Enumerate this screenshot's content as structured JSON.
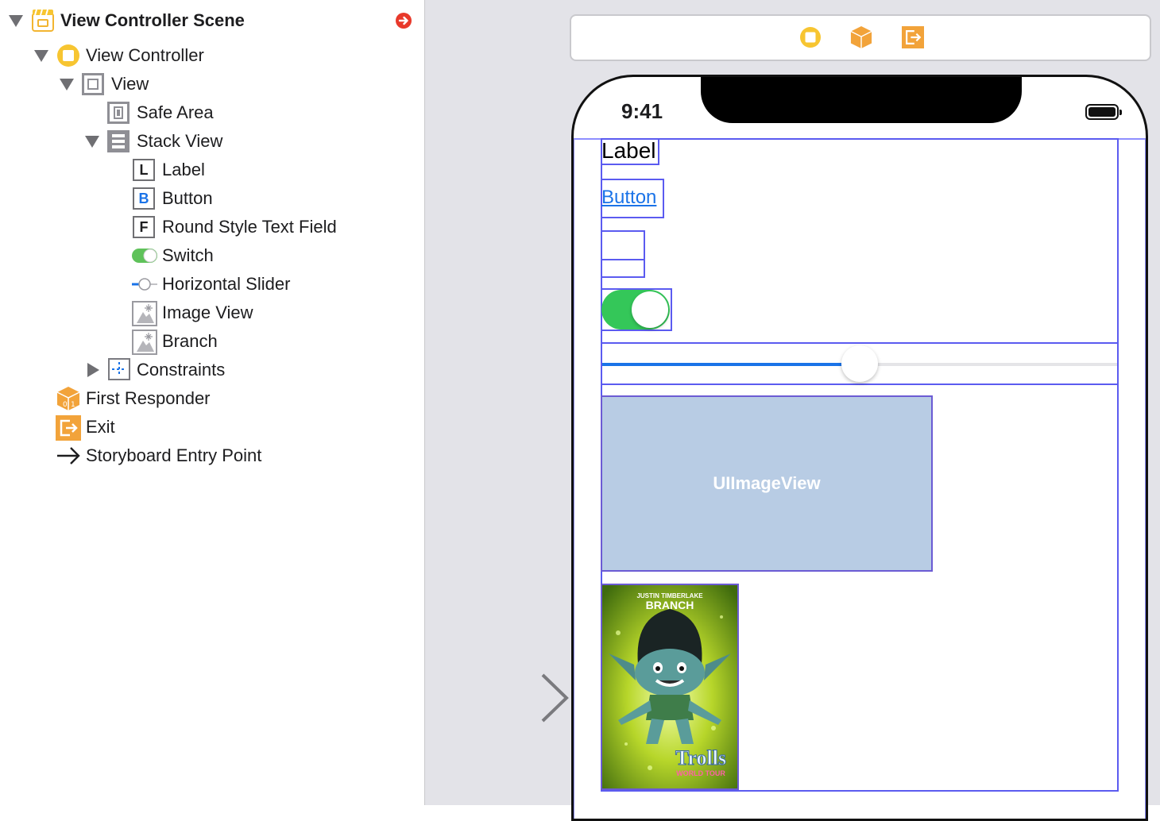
{
  "outline": {
    "scene": {
      "label": "View Controller Scene",
      "icon": "storyboard-scene-icon"
    },
    "items": [
      {
        "label": "View Controller"
      },
      {
        "label": "View"
      },
      {
        "label": "Safe Area"
      },
      {
        "label": "Stack View"
      },
      {
        "label": "Label",
        "badge": "L"
      },
      {
        "label": "Button",
        "badge": "B"
      },
      {
        "label": "Round Style Text Field",
        "badge": "F"
      },
      {
        "label": "Switch"
      },
      {
        "label": "Horizontal Slider"
      },
      {
        "label": "Image View"
      },
      {
        "label": "Branch"
      },
      {
        "label": "Constraints"
      },
      {
        "label": "First Responder"
      },
      {
        "label": "Exit"
      },
      {
        "label": "Storyboard Entry Point"
      }
    ]
  },
  "device": {
    "time": "9:41",
    "label_text": "Label",
    "button_text": "Button",
    "switch_on": true,
    "slider_value": 0.5,
    "imageview_placeholder": "UIImageView",
    "poster": {
      "top_text_1": "JUSTIN TIMBERLAKE",
      "top_text_2": "BRANCH",
      "logo_text": "Trolls",
      "logo_sub": "WORLD TOUR"
    }
  },
  "colors": {
    "accent": "#1a73e8",
    "switch_on": "#34c759",
    "selection": "#5b5bf0",
    "scene_icon": "#f7c531",
    "responder_icon": "#f2a33a"
  }
}
